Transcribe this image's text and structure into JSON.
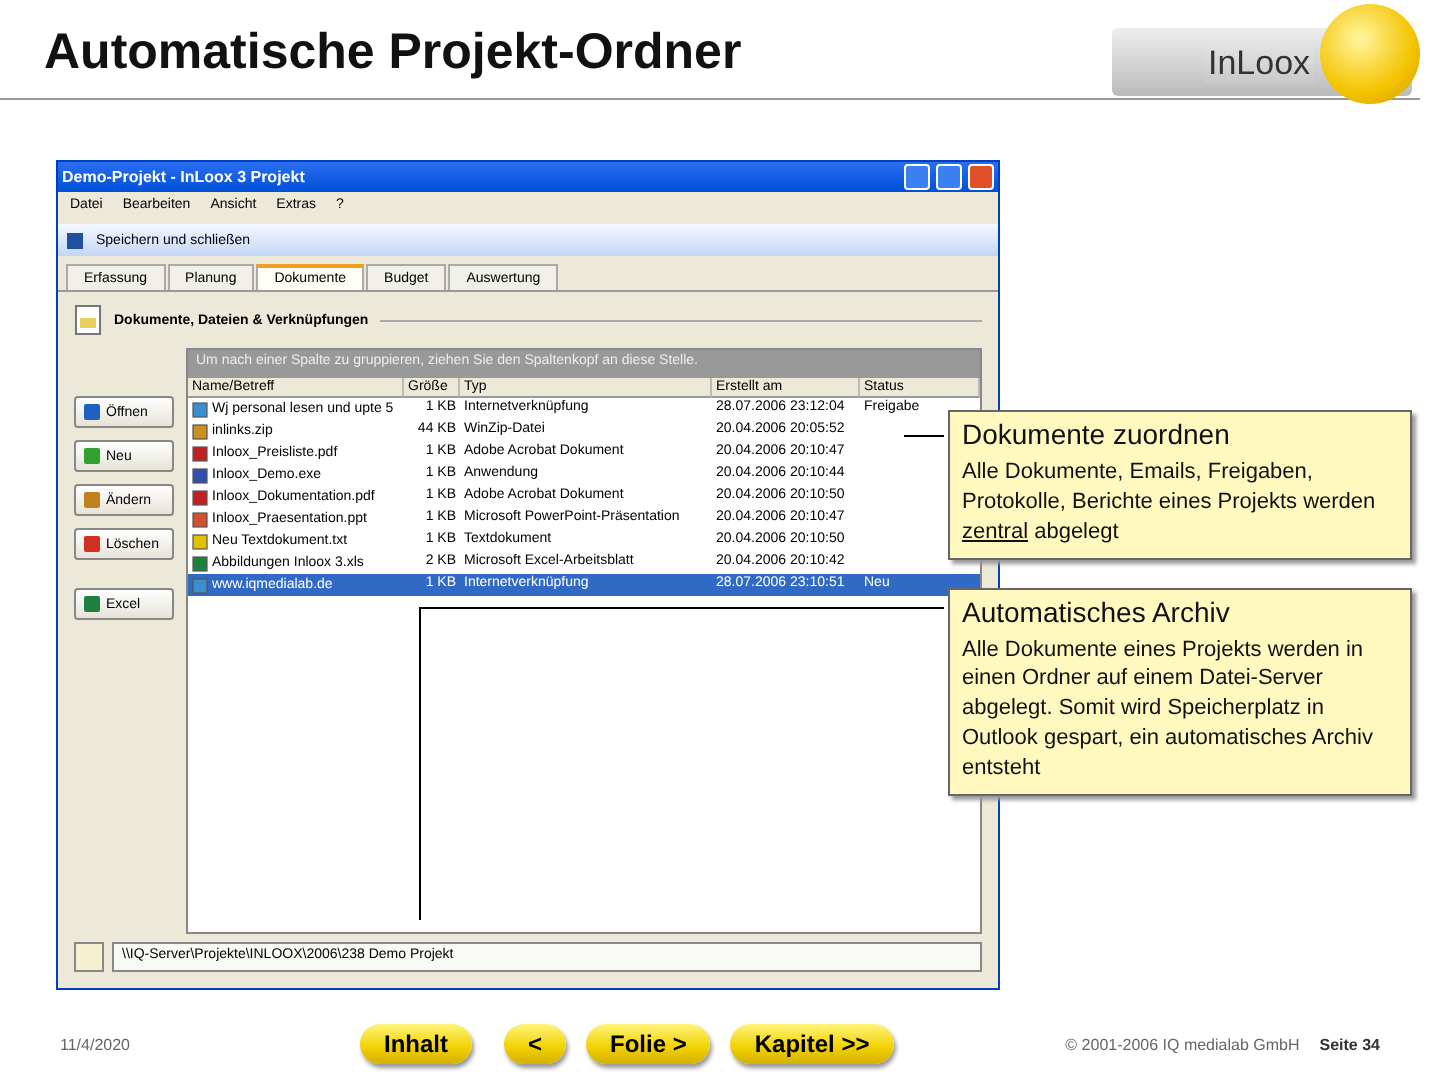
{
  "slide": {
    "title": "Automatische Projekt-Ordner",
    "logo": "InLoox"
  },
  "window": {
    "title": "Demo-Projekt - InLoox 3 Projekt",
    "menu": [
      "Datei",
      "Bearbeiten",
      "Ansicht",
      "Extras",
      "?"
    ],
    "toolbar": {
      "save": "Speichern und schließen"
    },
    "tabs": [
      {
        "label": "Erfassung",
        "selected": false
      },
      {
        "label": "Planung",
        "selected": false
      },
      {
        "label": "Dokumente",
        "selected": true
      },
      {
        "label": "Budget",
        "selected": false
      },
      {
        "label": "Auswertung",
        "selected": false
      }
    ],
    "section_title": "Dokumente, Dateien & Verknüpfungen",
    "side_buttons": [
      {
        "label": "Öffnen",
        "kind": "open"
      },
      {
        "label": "Neu",
        "kind": "new"
      },
      {
        "label": "Ändern",
        "kind": "edit"
      },
      {
        "label": "Löschen",
        "kind": "delete"
      },
      {
        "label": "Excel",
        "kind": "excel"
      }
    ],
    "group_hint": "Um nach einer Spalte zu gruppieren, ziehen Sie den Spaltenkopf an diese Stelle.",
    "columns": [
      "Name/Betreff",
      "Größe",
      "Typ",
      "Erstellt am",
      "Status"
    ],
    "rows": [
      {
        "kind": "link",
        "name": "Wj personal lesen und upte 5",
        "size": "1 KB",
        "type": "Internetverknüpfung",
        "created": "28.07.2006 23:12:04",
        "status": "Freigabe",
        "selected": false
      },
      {
        "kind": "zip",
        "name": "inlinks.zip",
        "size": "44 KB",
        "type": "WinZip-Datei",
        "created": "20.04.2006 20:05:52",
        "selected": false
      },
      {
        "kind": "pdf",
        "name": "Inloox_Preisliste.pdf",
        "size": "1 KB",
        "type": "Adobe Acrobat Dokument",
        "created": "20.04.2006 20:10:47",
        "selected": false
      },
      {
        "kind": "exe",
        "name": "Inloox_Demo.exe",
        "size": "1 KB",
        "type": "Anwendung",
        "created": "20.04.2006 20:10:44",
        "selected": false
      },
      {
        "kind": "pdf",
        "name": "Inloox_Dokumentation.pdf",
        "size": "1 KB",
        "type": "Adobe Acrobat Dokument",
        "created": "20.04.2006 20:10:50",
        "selected": false
      },
      {
        "kind": "ppt",
        "name": "Inloox_Praesentation.ppt",
        "size": "1 KB",
        "type": "Microsoft PowerPoint-Präsentation",
        "created": "20.04.2006 20:10:47",
        "selected": false
      },
      {
        "kind": "txt",
        "name": "Neu Textdokument.txt",
        "size": "1 KB",
        "type": "Textdokument",
        "created": "20.04.2006 20:10:50",
        "selected": false
      },
      {
        "kind": "xls",
        "name": "Abbildungen Inloox 3.xls",
        "size": "2 KB",
        "type": "Microsoft Excel-Arbeitsblatt",
        "created": "20.04.2006 20:10:42",
        "selected": false
      },
      {
        "kind": "link",
        "name": "www.iqmedialab.de",
        "size": "1 KB",
        "type": "Internetverknüpfung",
        "created": "28.07.2006 23:10:51",
        "status": "Neu",
        "selected": true
      }
    ],
    "path": "\\\\IQ-Server\\Projekte\\INLOOX\\2006\\238 Demo Projekt"
  },
  "callouts": [
    {
      "title": "Dokumente zuordnen",
      "parts": [
        {
          "text": "Alle Dokumente, Emails, Freigaben, Protokolle, Berichte eines Projekts werden ",
          "underline": false
        },
        {
          "text": "zentral",
          "underline": true
        },
        {
          "text": " abgelegt",
          "underline": false
        }
      ]
    },
    {
      "title": "Automatisches Archiv",
      "parts": [
        {
          "text": "Alle Dokumente eines Projekts werden in einen Ordner auf einem Datei-Server abgelegt. Somit wird Speicherplatz in Outlook gespart, ein automatisches Archiv entsteht",
          "underline": false
        }
      ]
    }
  ],
  "footer": {
    "date": "11/4/2020",
    "buttons": [
      "Inhalt",
      "<",
      "Folie >",
      "Kapitel >>"
    ],
    "copyright": "© 2001-2006 IQ medialab GmbH",
    "page": "Seite 34"
  }
}
